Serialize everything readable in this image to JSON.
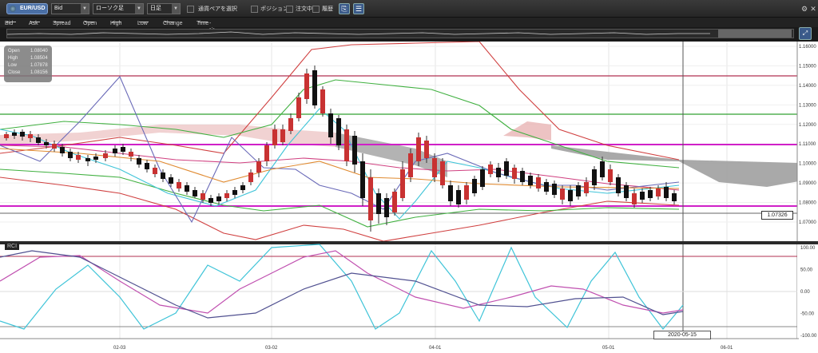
{
  "toolbar": {
    "symbol": "EUR/USD",
    "price_type": "Bid",
    "chart_type": "ローソク足",
    "period": "日足",
    "currency_pair_select": "通貨ペアを選択",
    "position": "ポジション",
    "order": "注文中",
    "history": "履歴"
  },
  "legend": {
    "items": [
      "Bid",
      "Ask",
      "Spread",
      "Open",
      "High",
      "Low",
      "Change",
      "Time"
    ],
    "time_value": "--:--"
  },
  "ohlc": {
    "open_label": "Open",
    "open": "1.08040",
    "high_label": "High",
    "high": "1.08504",
    "low_label": "Low",
    "low": "1.07878",
    "close_label": "Close",
    "close": "1.08156"
  },
  "price_axis": [
    "1.16000",
    "1.15000",
    "1.14000",
    "1.13000",
    "1.12000",
    "1.11000",
    "1.10000",
    "1.09000",
    "1.08000",
    "1.07000"
  ],
  "current_price_tag": "1.07326",
  "rci": {
    "label": "RCI",
    "axis": [
      "100.00",
      "50.00",
      "0.00",
      "-50.00",
      "-100.00"
    ]
  },
  "x_axis": [
    "02-03",
    "03-02",
    "04-01",
    "05-01",
    "06-01"
  ],
  "crosshair_date": "2020-05-15",
  "colors": {
    "bull_candle": "#c83232",
    "bear_candle": "#111111",
    "cloud_bull": "#e8b4b4",
    "cloud_bear": "#a0a0a0",
    "hline_magenta": "#d020c8",
    "hline_red": "#b03050",
    "hline_green": "#30a030"
  },
  "icons": {
    "flag": "us-flag-icon",
    "settings": "gear-icon",
    "close": "close-icon"
  }
}
